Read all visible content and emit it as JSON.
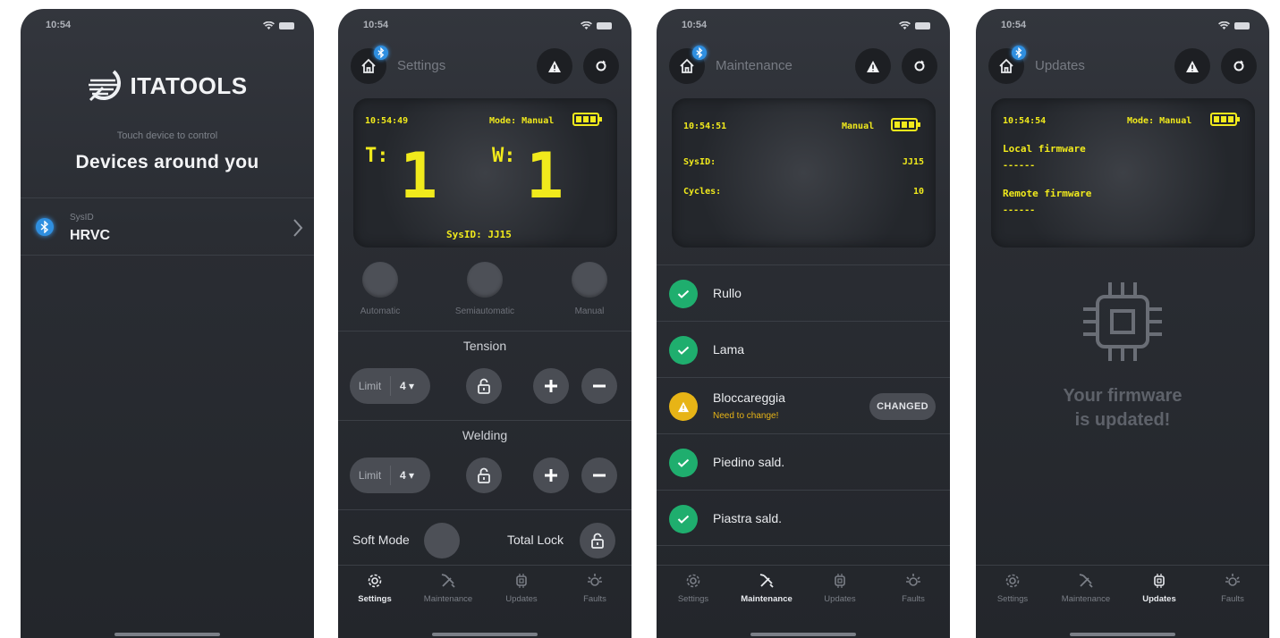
{
  "status_bar": {
    "time": "10:54"
  },
  "screen1": {
    "logo_text": "ITATOOLS",
    "hint": "Touch device to control",
    "title": "Devices around you",
    "device": {
      "label": "SysID",
      "name": "HRVC"
    }
  },
  "screen2": {
    "title": "Settings",
    "lcd": {
      "time": "10:54:49",
      "mode": "Mode: Manual",
      "t_label": "T:",
      "t_value": "1",
      "w_label": "W:",
      "w_value": "1",
      "sysid": "SysID: JJ15"
    },
    "modes": [
      "Automatic",
      "Semiautomatic",
      "Manual"
    ],
    "tension": {
      "title": "Tension",
      "limit_label": "Limit",
      "limit_value": "4 ▾"
    },
    "welding": {
      "title": "Welding",
      "limit_label": "Limit",
      "limit_value": "4 ▾"
    },
    "soft_mode": "Soft Mode",
    "total_lock": "Total Lock"
  },
  "screen3": {
    "title": "Maintenance",
    "lcd": {
      "time": "10:54:51",
      "mode": "Manual",
      "sysid_label": "SysID:",
      "sysid_value": "JJ15",
      "cycles_label": "Cycles:",
      "cycles_value": "10"
    },
    "items": [
      {
        "name": "Rullo",
        "status": "ok"
      },
      {
        "name": "Lama",
        "status": "ok"
      },
      {
        "name": "Bloccareggia",
        "status": "warn",
        "sub": "Need to change!",
        "button": "CHANGED"
      },
      {
        "name": "Piedino sald.",
        "status": "ok"
      },
      {
        "name": "Piastra sald.",
        "status": "ok"
      }
    ]
  },
  "screen4": {
    "title": "Updates",
    "lcd": {
      "time": "10:54:54",
      "mode": "Mode: Manual",
      "local_label": "Local firmware",
      "local_value": "------",
      "remote_label": "Remote firmware",
      "remote_value": "------"
    },
    "message_line1": "Your firmware",
    "message_line2": "is updated!"
  },
  "tabs": [
    "Settings",
    "Maintenance",
    "Updates",
    "Faults"
  ],
  "colors": {
    "accent_yellow": "#f1ea1c",
    "ok_green": "#1fae6e",
    "warn_amber": "#e7b416",
    "bluetooth_blue": "#2f8fe0"
  }
}
